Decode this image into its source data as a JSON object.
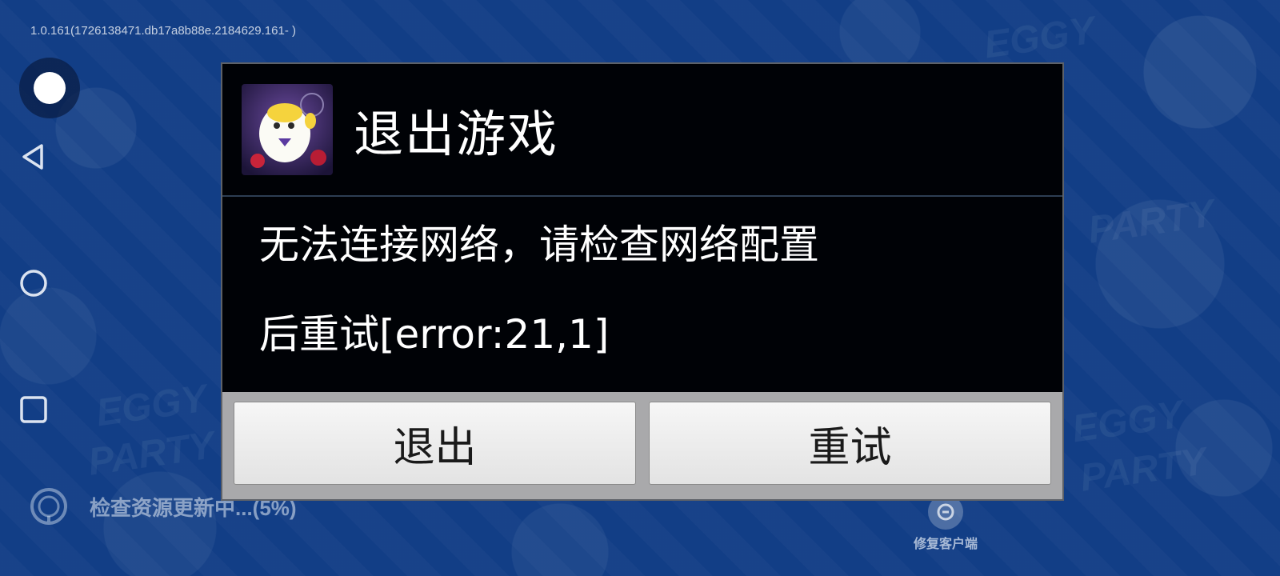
{
  "version": "1.0.161(1726138471.db17a8b88e.2184629.161- )",
  "background": {
    "watermarks": [
      "EGGY",
      "PARTY",
      "EGGY",
      "PARTY",
      "EGGY",
      "PARTY"
    ]
  },
  "nav": {
    "home": "home-dot-icon",
    "back": "back-triangle-icon",
    "circle": "home-circle-icon",
    "recents": "recents-square-icon"
  },
  "status": {
    "progress_text": "检查资源更新中...(5%)",
    "progress_percent": 5
  },
  "repair": {
    "label": "修复客户端"
  },
  "dialog": {
    "title": "退出游戏",
    "message_line1": "无法连接网络，请检查网络配置",
    "message_line2": "后重试[error:21,1]",
    "buttons": {
      "exit_label": "退出",
      "retry_label": "重试"
    }
  },
  "colors": {
    "background": "#123e86",
    "dialog_bg": "#000206",
    "dialog_footer": "#a9a9ab",
    "button_bg": "#f0f0f0",
    "accent_yellow": "#f5d33d"
  }
}
